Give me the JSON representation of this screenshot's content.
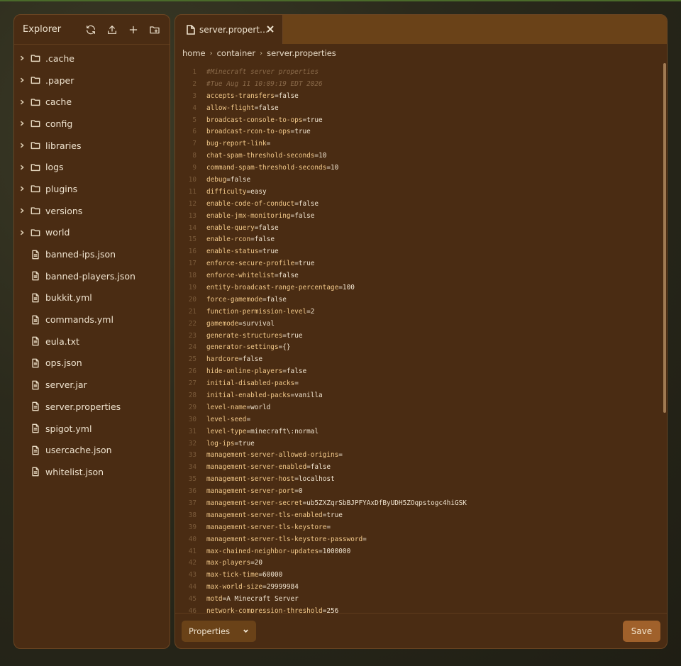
{
  "explorer": {
    "title": "Explorer",
    "icons": [
      "refresh-icon",
      "upload-icon",
      "plus-icon",
      "folder-add-icon"
    ],
    "items": [
      {
        "type": "folder",
        "name": ".cache"
      },
      {
        "type": "folder",
        "name": ".paper"
      },
      {
        "type": "folder",
        "name": "cache"
      },
      {
        "type": "folder",
        "name": "config"
      },
      {
        "type": "folder",
        "name": "libraries"
      },
      {
        "type": "folder",
        "name": "logs"
      },
      {
        "type": "folder",
        "name": "plugins"
      },
      {
        "type": "folder",
        "name": "versions"
      },
      {
        "type": "folder",
        "name": "world"
      },
      {
        "type": "file",
        "name": "banned-ips.json"
      },
      {
        "type": "file",
        "name": "banned-players.json"
      },
      {
        "type": "file",
        "name": "bukkit.yml"
      },
      {
        "type": "file",
        "name": "commands.yml"
      },
      {
        "type": "file",
        "name": "eula.txt"
      },
      {
        "type": "file",
        "name": "ops.json"
      },
      {
        "type": "file",
        "name": "server.jar"
      },
      {
        "type": "file",
        "name": "server.properties"
      },
      {
        "type": "file",
        "name": "spigot.yml"
      },
      {
        "type": "file",
        "name": "usercache.json"
      },
      {
        "type": "file",
        "name": "whitelist.json"
      }
    ]
  },
  "editor": {
    "tab": {
      "label": "server.propert…"
    },
    "breadcrumb": [
      "home",
      "container",
      "server.properties"
    ],
    "lines": [
      "#Minecraft server properties",
      "#Tue Aug 11 10:09:19 EDT 2026",
      "accepts-transfers=false",
      "allow-flight=false",
      "broadcast-console-to-ops=true",
      "broadcast-rcon-to-ops=true",
      "bug-report-link=",
      "chat-spam-threshold-seconds=10",
      "command-spam-threshold-seconds=10",
      "debug=false",
      "difficulty=easy",
      "enable-code-of-conduct=false",
      "enable-jmx-monitoring=false",
      "enable-query=false",
      "enable-rcon=false",
      "enable-status=true",
      "enforce-secure-profile=true",
      "enforce-whitelist=false",
      "entity-broadcast-range-percentage=100",
      "force-gamemode=false",
      "function-permission-level=2",
      "gamemode=survival",
      "generate-structures=true",
      "generator-settings={}",
      "hardcore=false",
      "hide-online-players=false",
      "initial-disabled-packs=",
      "initial-enabled-packs=vanilla",
      "level-name=world",
      "level-seed=",
      "level-type=minecraft\\:normal",
      "log-ips=true",
      "management-server-allowed-origins=",
      "management-server-enabled=false",
      "management-server-host=localhost",
      "management-server-port=0",
      "management-server-secret=ub5ZXZqrSbBJPFYAxDfByUDH5ZOqpstogc4hiGSK",
      "management-server-tls-enabled=true",
      "management-server-tls-keystore=",
      "management-server-tls-keystore-password=",
      "max-chained-neighbor-updates=1000000",
      "max-players=20",
      "max-tick-time=60000",
      "max-world-size=29999984",
      "motd=A Minecraft Server",
      "network-compression-threshold=256"
    ],
    "footer": {
      "select_value": "Properties",
      "save_label": "Save"
    }
  },
  "colors": {
    "panel_bg": "#4a2c13",
    "tab_bar_bg": "#6a4218",
    "save_button_bg": "#a0612b",
    "comment": "#8a6a4a",
    "key": "#f2c98a"
  }
}
